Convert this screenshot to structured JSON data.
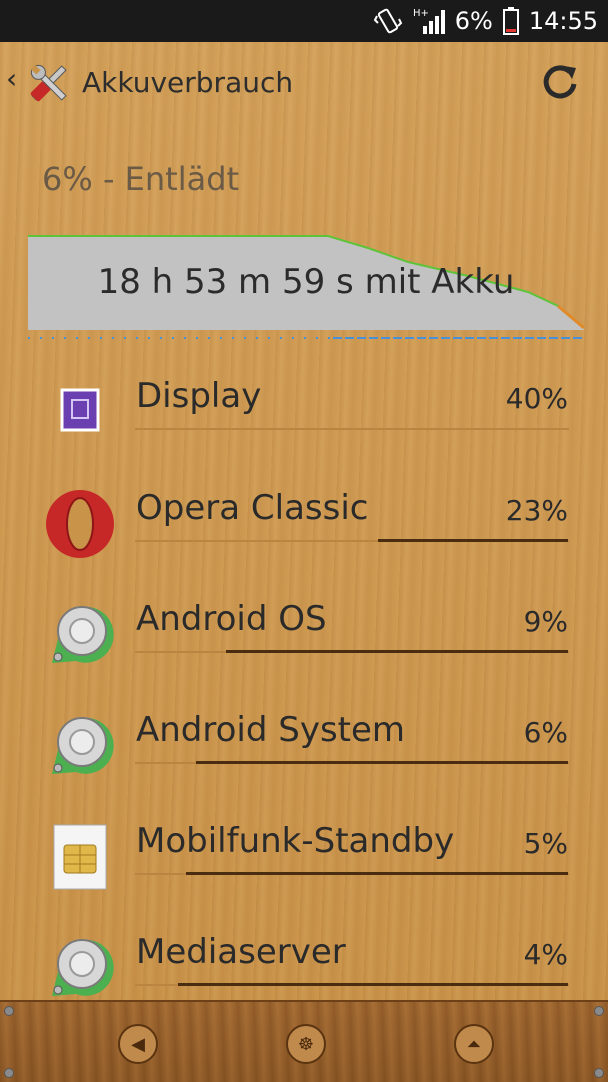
{
  "status_bar": {
    "battery_percent": "6%",
    "time": "14:55",
    "network": "H+"
  },
  "header": {
    "title": "Akkuverbrauch"
  },
  "summary": {
    "status": "6% - Entlädt",
    "duration": "18 h 53 m 59 s mit Akku"
  },
  "apps": [
    {
      "name": "Display",
      "percent": "40%",
      "icon": "display-icon"
    },
    {
      "name": "Opera Classic",
      "percent": "23%",
      "icon": "opera-icon"
    },
    {
      "name": "Android OS",
      "percent": "9%",
      "icon": "android-gear-icon"
    },
    {
      "name": "Android System",
      "percent": "6%",
      "icon": "android-gear-icon"
    },
    {
      "name": "Mobilfunk-Standby",
      "percent": "5%",
      "icon": "sim-card-icon"
    },
    {
      "name": "Mediaserver",
      "percent": "4%",
      "icon": "android-gear-icon"
    }
  ],
  "colors": {
    "graph_fill": "#c2c2c2",
    "graph_line": "#5fc33a",
    "bar": "#4a2c10"
  }
}
